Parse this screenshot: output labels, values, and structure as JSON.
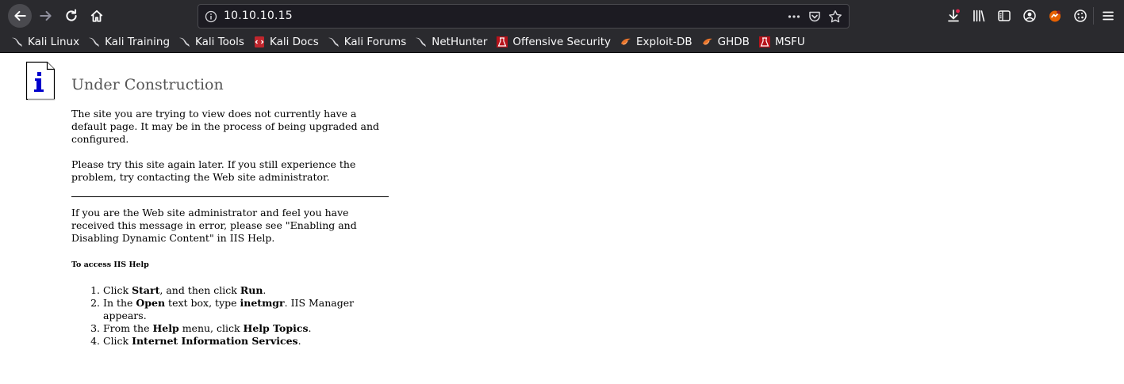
{
  "browser": {
    "url": "10.10.10.15",
    "bookmarks": [
      {
        "label": "Kali Linux",
        "icon": "kali-dragon-icon"
      },
      {
        "label": "Kali Training",
        "icon": "kali-dragon-icon"
      },
      {
        "label": "Kali Tools",
        "icon": "kali-dragon-icon"
      },
      {
        "label": "Kali Docs",
        "icon": "kali-docs-icon"
      },
      {
        "label": "Kali Forums",
        "icon": "kali-dragon-icon"
      },
      {
        "label": "NetHunter",
        "icon": "kali-dragon-icon"
      },
      {
        "label": "Offensive Security",
        "icon": "offsec-icon"
      },
      {
        "label": "Exploit-DB",
        "icon": "exploitdb-icon"
      },
      {
        "label": "GHDB",
        "icon": "exploitdb-icon"
      },
      {
        "label": "MSFU",
        "icon": "offsec-icon"
      }
    ],
    "colors": {
      "chrome": "#2a2a2e",
      "urlbar": "#1c1b22",
      "text": "#f9f9fa"
    }
  },
  "page": {
    "title": "Under Construction",
    "paragraph1": "The site you are trying to view does not currently have a default page. It may be in the process of being upgraded and configured.",
    "paragraph2": "Please try this site again later. If you still experience the problem, try contacting the Web site administrator.",
    "paragraph3": "If you are the Web site administrator and feel you have received this message in error, please see \"Enabling and Disabling Dynamic Content\" in IIS Help.",
    "help_heading": "To access IIS Help",
    "steps": [
      {
        "parts": [
          "Click ",
          "Start",
          ", and then click ",
          "Run",
          "."
        ]
      },
      {
        "parts": [
          "In the ",
          "Open",
          " text box, type ",
          "inetmgr",
          ". IIS Manager appears."
        ]
      },
      {
        "parts": [
          "From the ",
          "Help",
          " menu, click ",
          "Help Topics",
          "."
        ]
      },
      {
        "parts": [
          "Click ",
          "Internet Information Services",
          "."
        ]
      }
    ]
  }
}
